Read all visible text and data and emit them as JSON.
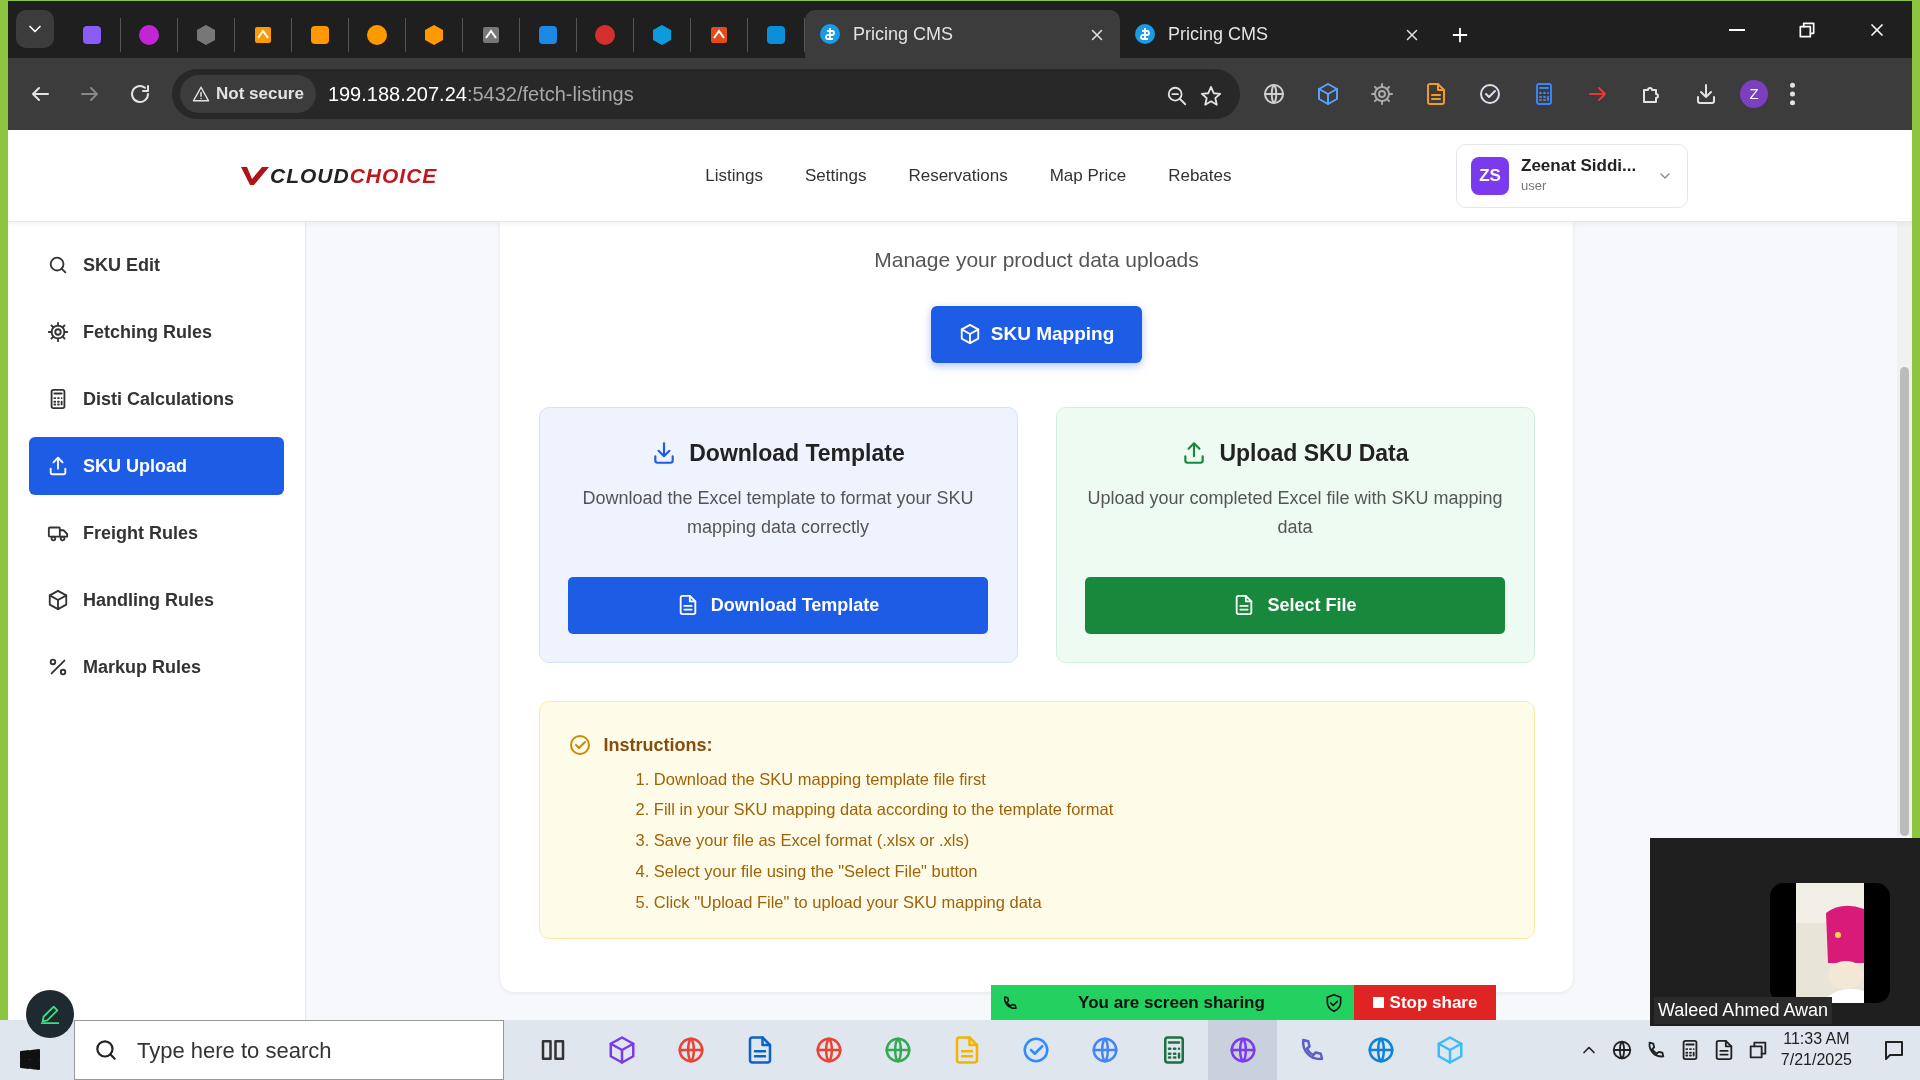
{
  "browser": {
    "tabs": [
      {
        "kind": "icon",
        "selected": false
      },
      {
        "kind": "icon",
        "selected": false
      },
      {
        "kind": "icon",
        "selected": false
      },
      {
        "kind": "icon",
        "selected": false
      },
      {
        "kind": "icon",
        "selected": false
      },
      {
        "kind": "icon",
        "selected": false
      },
      {
        "kind": "icon",
        "selected": false
      },
      {
        "kind": "icon",
        "selected": false
      },
      {
        "kind": "icon",
        "selected": false
      },
      {
        "kind": "icon",
        "selected": false
      },
      {
        "kind": "icon",
        "selected": false
      },
      {
        "kind": "icon",
        "selected": false
      },
      {
        "kind": "icon",
        "selected": false
      },
      {
        "kind": "titled",
        "title": "Pricing CMS",
        "selected": true
      },
      {
        "kind": "titled",
        "title": "Pricing CMS",
        "selected": false
      }
    ],
    "security": "Not secure",
    "host": "199.188.207.24",
    "path": ":5432/fetch-listings",
    "profile": "Z"
  },
  "header": {
    "logo": {
      "first": "CLOUD",
      "second": "CHOICE"
    },
    "nav": [
      "Listings",
      "Settings",
      "Reservations",
      "Map Price",
      "Rebates"
    ],
    "user": {
      "initials": "ZS",
      "name": "Zeenat Siddi...",
      "role": "user"
    }
  },
  "sidebar": {
    "items": [
      {
        "label": "SKU Edit",
        "selected": false
      },
      {
        "label": "Fetching Rules",
        "selected": false
      },
      {
        "label": "Disti Calculations",
        "selected": false
      },
      {
        "label": "SKU Upload",
        "selected": true
      },
      {
        "label": "Freight Rules",
        "selected": false
      },
      {
        "label": "Handling Rules",
        "selected": false
      },
      {
        "label": "Markup Rules",
        "selected": false
      }
    ]
  },
  "main": {
    "subtitle": "Manage your product data uploads",
    "mapping_button": "SKU Mapping",
    "panels": [
      {
        "kind": "download",
        "title": "Download Template",
        "text": "Download the Excel template to format your SKU mapping data correctly",
        "button": "Download Template"
      },
      {
        "kind": "upload",
        "title": "Upload SKU Data",
        "text": "Upload your completed Excel file with SKU mapping data",
        "button": "Select File"
      }
    ],
    "instructions": {
      "title": "Instructions:",
      "steps": [
        "1. Download the SKU mapping template file first",
        "2. Fill in your SKU mapping data according to the template format",
        "3. Save your file as Excel format (.xlsx or .xls)",
        "4. Select your file using the \"Select File\" button",
        "5. Click \"Upload File\" to upload your SKU mapping data"
      ]
    }
  },
  "screen_share": {
    "message": "You are screen sharing",
    "stop": "Stop share"
  },
  "video": {
    "kind": "picture",
    "name": "Waleed Ahmed Awan"
  },
  "taskbar": {
    "search_placeholder": "Type here to search",
    "time": "11:33 AM",
    "date": "7/21/2025"
  }
}
